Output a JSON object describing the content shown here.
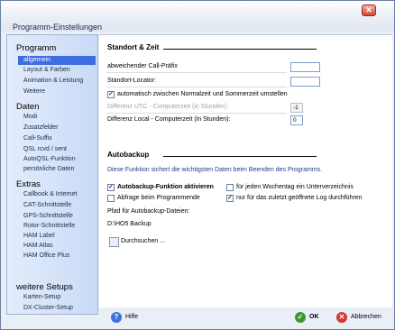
{
  "window": {
    "title": "Programm-Einstellungen",
    "close_glyph": "✕"
  },
  "sidebar": {
    "groups": [
      {
        "heading": "Programm",
        "items": [
          "allgemein",
          "Layout & Farben",
          "Animation & Leistung",
          "Weitere"
        ]
      },
      {
        "heading": "Daten",
        "items": [
          "Modi",
          "Zusatzfelder",
          "Call-Suffix",
          "QSL rcvd / sent",
          "AutoQSL-Funktion",
          "persönliche Daten"
        ]
      },
      {
        "heading": "Extras",
        "items": [
          "Callbook & Internet",
          "CAT-Schnittstelle",
          "GPS-Schnittstelle",
          "Rotor-Schnittstelle",
          "HAM Label",
          "HAM Atlas",
          "HAM Office Plus"
        ]
      },
      {
        "heading": "weitere Setups",
        "items": [
          "Karten-Setup",
          "DX-Cluster-Setup"
        ]
      }
    ],
    "selected": "allgemein"
  },
  "standort": {
    "title": "Standort & Zeit",
    "call_prefix_label": "abweichender Call-Präfix",
    "call_prefix_value": "",
    "locator_label": "Standort-Locator:",
    "locator_value": "",
    "auto_time_label": "automatisch zwischen Normalzeit und Sommerzeit umstellen",
    "auto_time_checked": true,
    "utc_diff_label": "Differenz UTC - Computerzeit (in Stunden):",
    "utc_diff_value": "-1",
    "local_diff_label": "Differenz Local - Computerzeit (in Stunden):",
    "local_diff_value": "0"
  },
  "autobackup": {
    "title": "Autobackup",
    "description": "Diese Funktion sichert die wichtigsten Daten beim Beenden des Programms.",
    "enable_label": "Autobackup-Funktion aktivieren",
    "enable_checked": true,
    "ask_label": "Abfrage beim Programmende",
    "ask_checked": false,
    "weekday_label": "für jeden Wochentag ein Unterverzeichnis",
    "weekday_checked": false,
    "last_log_label": "nur für das zuletzt geöffnete Log durchführen",
    "last_log_checked": true,
    "path_label": "Pfad für Autobackup-Dateien:",
    "path_value": "D:\\HO5 Backup",
    "browse_label": "Durchsuchen ..."
  },
  "footer": {
    "help_label": "Hilfe",
    "ok_label": "OK",
    "cancel_label": "Abbrechen"
  },
  "colors": {
    "selected_bg": "#3e6ce1",
    "help_icon": "#3c72d6",
    "ok_icon": "#3b9a2e",
    "cancel_icon": "#d23b2a"
  },
  "icons": {
    "help": "help-icon",
    "ok": "ok-icon",
    "cancel": "cancel-icon",
    "browse": "folder-icon"
  }
}
